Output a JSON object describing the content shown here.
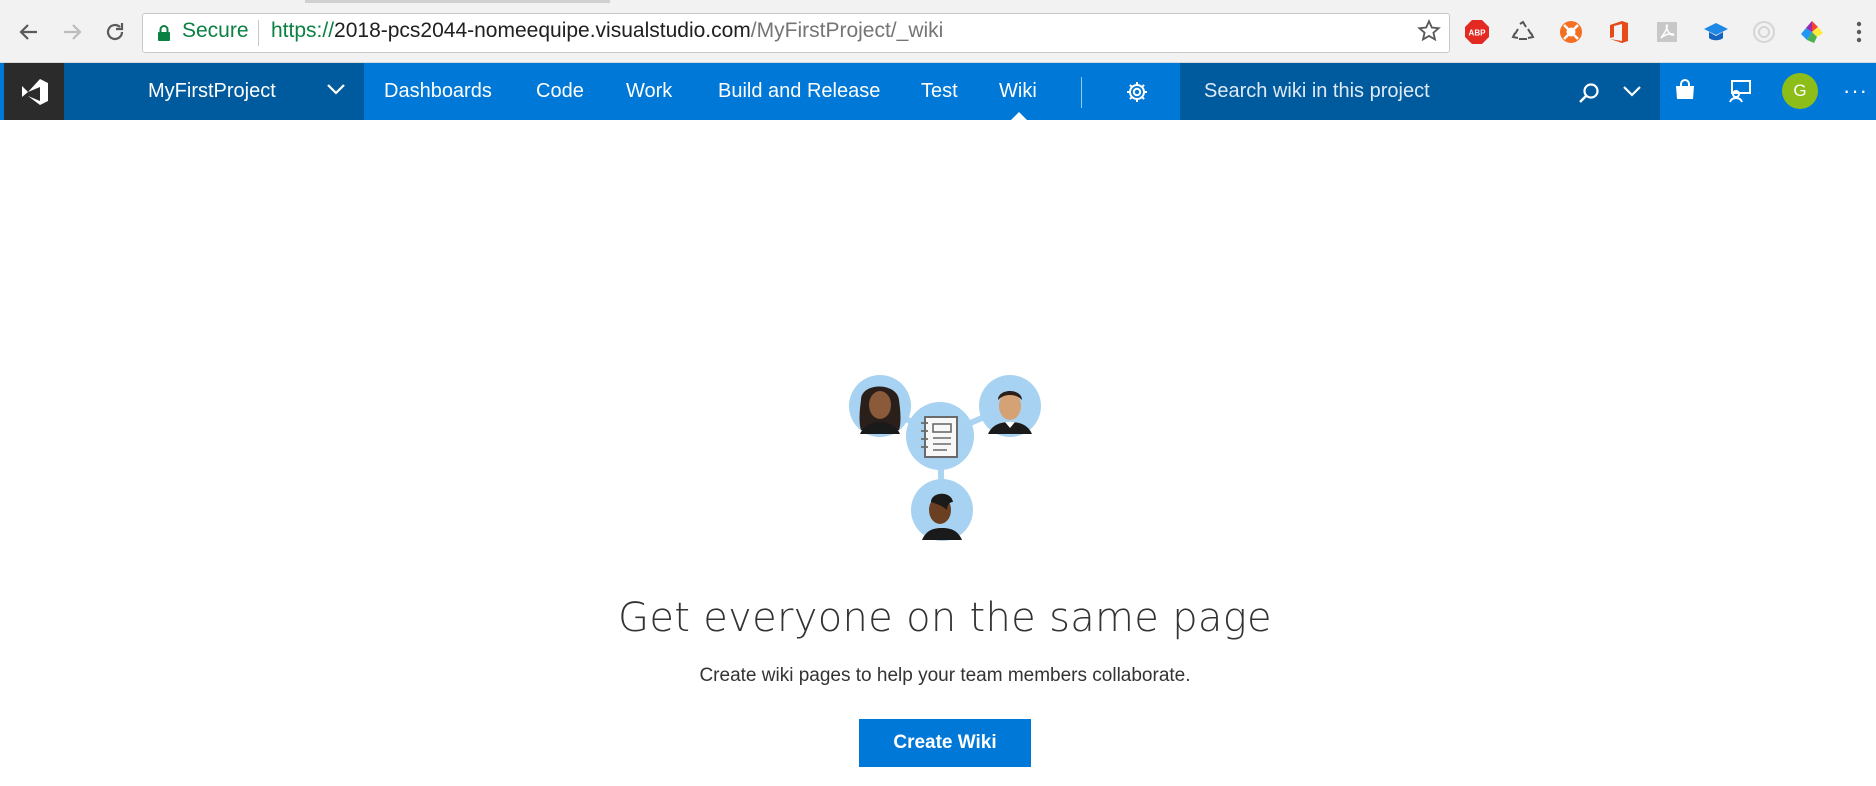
{
  "browser": {
    "secure_label": "Secure",
    "url_scheme": "https://",
    "url_host": "2018-pcs2044-nomeequipe.visualstudio.com",
    "url_path": "/MyFirstProject/_wiki",
    "toolbar_icons": [
      "back-icon",
      "forward-icon",
      "reload-icon",
      "lock-icon",
      "bookmark-star-icon",
      "adblock-icon",
      "recycle-icon",
      "lifebuoy-icon",
      "office-icon",
      "pdf-icon",
      "graduation-cap-icon",
      "target-icon",
      "color-picker-icon",
      "kebab-menu-icon"
    ],
    "adblock_label": "ABP"
  },
  "appbar": {
    "project_name": "MyFirstProject",
    "nav_items": [
      "Dashboards",
      "Code",
      "Work",
      "Build and Release",
      "Test",
      "Wiki"
    ],
    "active_item": "Wiki",
    "search_placeholder": "Search wiki in this project",
    "avatar_initial": "G",
    "more_label": "···",
    "colors": {
      "bar": "#0078d7",
      "dark": "#005a9e",
      "logo_bg": "#2b2b2b",
      "avatar": "#8cbd18"
    }
  },
  "main": {
    "headline": "Get everyone on the same page",
    "subline": "Create wiki pages to help your team members collaborate.",
    "cta_label": "Create Wiki",
    "illustration": "wiki-collaboration-illustration"
  }
}
